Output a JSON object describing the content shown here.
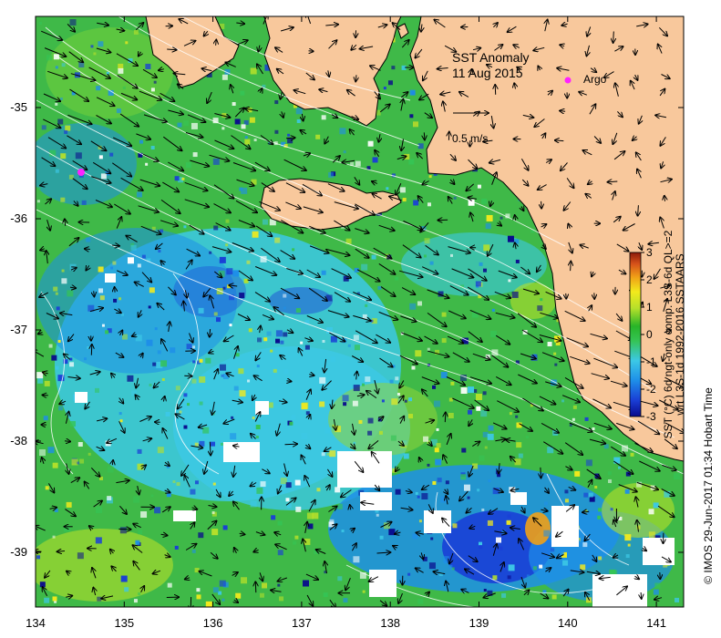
{
  "title": "SST Anomaly",
  "date": "11 Aug 2015",
  "legend": {
    "argo_label": "Argo",
    "argo_color": "#ff22ff",
    "velocity_scale_label": "0.5 m/s"
  },
  "x_ticks": [
    "134",
    "135",
    "136",
    "137",
    "138",
    "139",
    "140",
    "141"
  ],
  "y_ticks": [
    "-35",
    "-36",
    "-37",
    "-38",
    "-39"
  ],
  "colorbar": {
    "ticks": [
      "3",
      "2",
      "1",
      "0",
      "-1",
      "-2",
      "-3"
    ],
    "label_line1": "SST (°C) 6d ngt-only comp. L3S-6d QL>=2",
    "label_line2": "wrt L3S-1d 1992-2016 SSTAARS",
    "colors": [
      "#0a0a8c",
      "#1a3fd6",
      "#1e8fe8",
      "#3cc8e6",
      "#35c455",
      "#28b428",
      "#b6e02a",
      "#f2ea1c",
      "#f0a017",
      "#d6521a",
      "#8c1a0a"
    ]
  },
  "credit": "© IMOS 29-Jun-2017 01:34 Hobart Time",
  "colors": {
    "land": "#f8c89c",
    "ocean_base": "#3fb948"
  }
}
